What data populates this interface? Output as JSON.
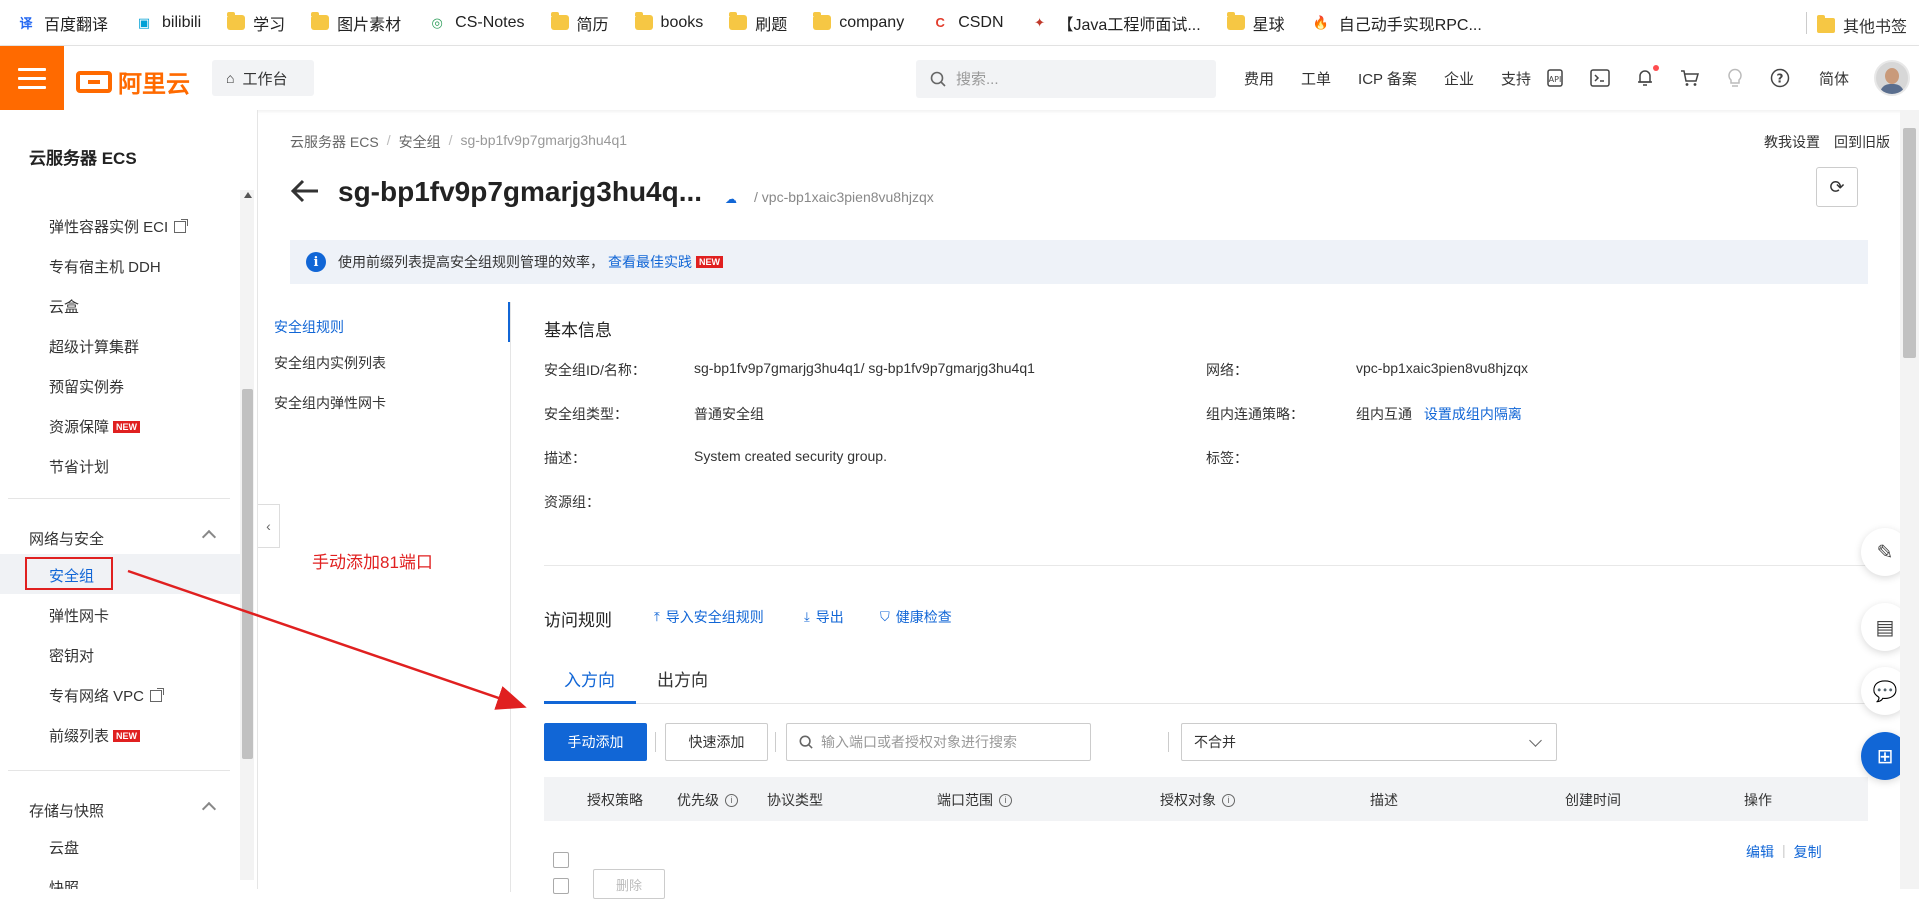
{
  "bookmarks": {
    "items": [
      {
        "label": "百度翻译",
        "icon": "translate-icon",
        "icon_text": "译",
        "color": "#2468f2"
      },
      {
        "label": "bilibili",
        "icon": "bilibili-icon",
        "icon_text": "▣",
        "color": "#00a1d6"
      },
      {
        "label": "学习",
        "icon": "folder-icon"
      },
      {
        "label": "图片素材",
        "icon": "folder-icon"
      },
      {
        "label": "CS-Notes",
        "icon": "cs-notes-icon",
        "icon_text": "◎",
        "color": "#2e9e5b"
      },
      {
        "label": "简历",
        "icon": "folder-icon"
      },
      {
        "label": "books",
        "icon": "folder-icon"
      },
      {
        "label": "刷题",
        "icon": "folder-icon"
      },
      {
        "label": "company",
        "icon": "folder-icon"
      },
      {
        "label": "CSDN",
        "icon": "csdn-icon",
        "icon_text": "C",
        "color": "#e23c2c"
      },
      {
        "label": "【Java工程师面试...",
        "icon": "java-icon",
        "icon_text": "✦",
        "color": "#c0392b"
      },
      {
        "label": "星球",
        "icon": "folder-icon"
      },
      {
        "label": "自己动手实现RPC...",
        "icon": "flame-icon",
        "icon_text": "🔥",
        "color": "#e23c2c"
      }
    ],
    "other": "其他书签"
  },
  "topnav": {
    "brand": "阿里云",
    "workbench": "工作台",
    "search_placeholder": "搜索...",
    "links": [
      "费用",
      "工单",
      "ICP 备案",
      "企业",
      "支持"
    ],
    "lang": "简体",
    "accent": "#ff6a00"
  },
  "sidebar": {
    "title": "云服务器 ECS",
    "items": [
      {
        "label": "弹性容器实例 ECI",
        "external": true
      },
      {
        "label": "专有宿主机 DDH"
      },
      {
        "label": "云盒"
      },
      {
        "label": "超级计算集群"
      },
      {
        "label": "预留实例券"
      },
      {
        "label": "资源保障",
        "badge": "NEW"
      },
      {
        "label": "节省计划"
      }
    ],
    "group_network": "网络与安全",
    "network_items": [
      {
        "label": "安全组",
        "active": true
      },
      {
        "label": "弹性网卡"
      },
      {
        "label": "密钥对"
      },
      {
        "label": "专有网络 VPC",
        "external": true
      },
      {
        "label": "前缀列表",
        "badge": "NEW"
      }
    ],
    "group_storage": "存储与快照",
    "storage_items": [
      {
        "label": "云盘"
      },
      {
        "label": "快照"
      }
    ]
  },
  "main": {
    "breadcrumb": [
      "云服务器 ECS",
      "安全组",
      "sg-bp1fv9p7gmarjg3hu4q1"
    ],
    "top_links": [
      "教我设置",
      "回到旧版"
    ],
    "title": "sg-bp1fv9p7gmarjg3hu4q...",
    "vpc": "/ vpc-bp1xaic3pien8vu8hjzqx",
    "notice_text": "使用前缀列表提高安全组规则管理的效率，",
    "notice_link": "查看最佳实践",
    "notice_badge": "NEW",
    "subnav": [
      "安全组规则",
      "安全组内实例列表",
      "安全组内弹性网卡"
    ],
    "basic_title": "基本信息",
    "basic_info": {
      "id_label": "安全组ID/名称：",
      "id_value": "sg-bp1fv9p7gmarjg3hu4q1/ sg-bp1fv9p7gmarjg3hu4q1",
      "net_label": "网络：",
      "net_value": "vpc-bp1xaic3pien8vu8hjzqx",
      "type_label": "安全组类型：",
      "type_value": "普通安全组",
      "policy_label": "组内连通策略：",
      "policy_value": "组内互通",
      "policy_link": "设置成组内隔离",
      "desc_label": "描述：",
      "desc_value": "System created security group.",
      "tag_label": "标签：",
      "rg_label": "资源组："
    },
    "rules_title": "访问规则",
    "rule_actions": [
      "导入安全组规则",
      "导出",
      "健康检查"
    ],
    "tabs": [
      "入方向",
      "出方向"
    ],
    "btn_manual": "手动添加",
    "btn_quick": "快速添加",
    "search_placeholder": "输入端口或者授权对象进行搜索",
    "merge_value": "不合并",
    "columns": [
      "授权策略",
      "优先级",
      "协议类型",
      "端口范围",
      "授权对象",
      "描述",
      "创建时间",
      "操作"
    ],
    "row_actions": [
      "编辑",
      "复制"
    ],
    "btn_delete": "删除",
    "annotation": "手动添加81端口",
    "primary": "#1166d6",
    "annotation_color": "#e02020"
  }
}
